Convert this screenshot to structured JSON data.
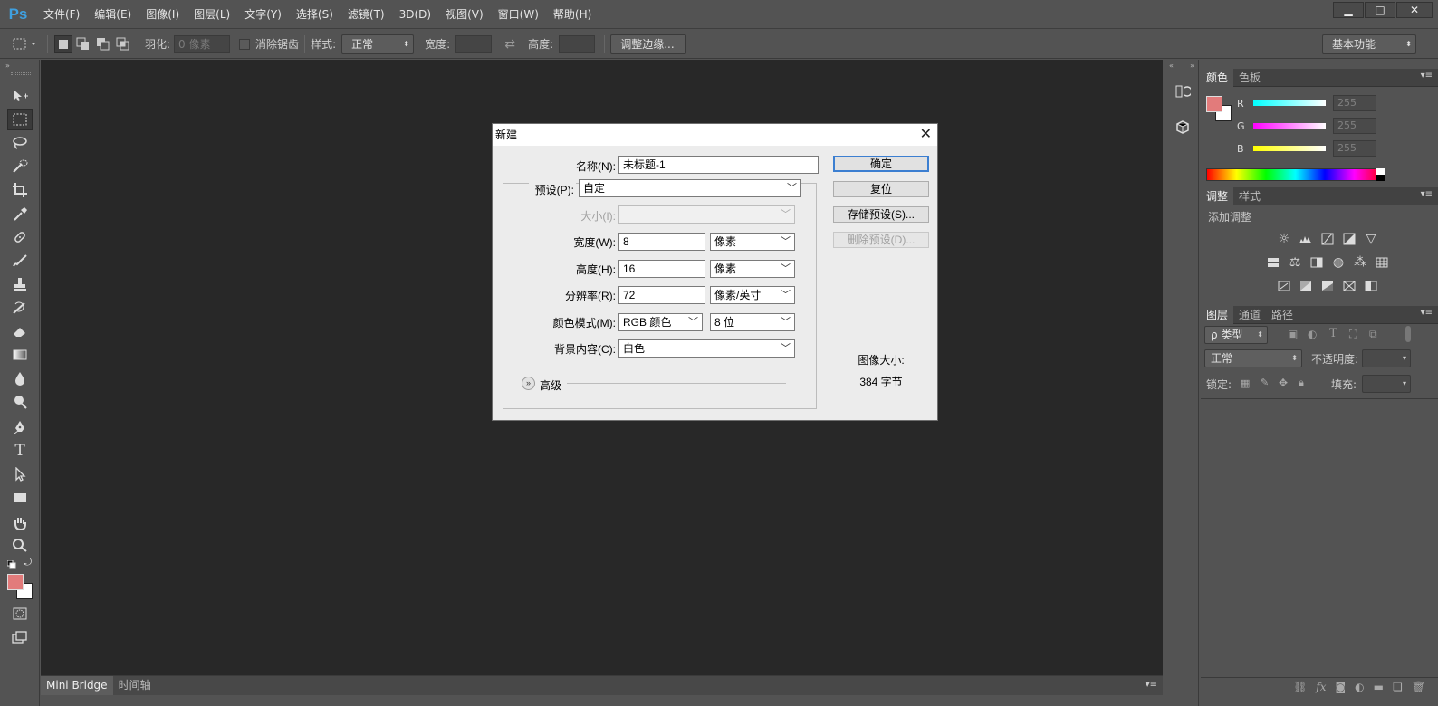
{
  "app": {
    "logo": "Ps"
  },
  "menu": [
    "文件(F)",
    "编辑(E)",
    "图像(I)",
    "图层(L)",
    "文字(Y)",
    "选择(S)",
    "滤镜(T)",
    "3D(D)",
    "视图(V)",
    "窗口(W)",
    "帮助(H)"
  ],
  "window_controls": {
    "minimize": "▁",
    "maximize": "□",
    "close": "✕"
  },
  "options": {
    "feather_label": "羽化:",
    "feather_value": "0 像素",
    "antialias_label": "消除锯齿",
    "style_label": "样式:",
    "style_value": "正常",
    "width_label": "宽度:",
    "height_label": "高度:",
    "refine_edge": "调整边缘...",
    "workspace": "基本功能"
  },
  "bottom_tabs": [
    "Mini Bridge",
    "时间轴"
  ],
  "colors": {
    "foreground": "#e27b7b",
    "background": "#ffffff",
    "canvas": "#282828",
    "panel": "#535353"
  },
  "color_panel": {
    "tabs": [
      "颜色",
      "色板"
    ],
    "channels": [
      {
        "label": "R",
        "value": "255"
      },
      {
        "label": "G",
        "value": "255"
      },
      {
        "label": "B",
        "value": "255"
      }
    ]
  },
  "adjust_panel": {
    "tabs": [
      "调整",
      "样式"
    ],
    "heading": "添加调整"
  },
  "layers_panel": {
    "tabs": [
      "图层",
      "通道",
      "路径"
    ],
    "filter_label": "ρ 类型",
    "blend_mode": "正常",
    "opacity_label": "不透明度:",
    "lock_label": "锁定:",
    "fill_label": "填充:"
  },
  "dialog": {
    "title": "新建",
    "close": "✕",
    "name_label": "名称(N):",
    "name_value": "未标题-1",
    "preset_label": "预设(P):",
    "preset_value": "自定",
    "size_label": "大小(I):",
    "width_label": "宽度(W):",
    "width_value": "8",
    "width_unit": "像素",
    "height_label": "高度(H):",
    "height_value": "16",
    "height_unit": "像素",
    "resolution_label": "分辨率(R):",
    "resolution_value": "72",
    "resolution_unit": "像素/英寸",
    "color_mode_label": "颜色模式(M):",
    "color_mode_value": "RGB 颜色",
    "bit_depth": "8 位",
    "background_label": "背景内容(C):",
    "background_value": "白色",
    "advanced_label": "高级",
    "buttons": {
      "ok": "确定",
      "reset": "复位",
      "save_preset": "存储预设(S)...",
      "delete_preset": "删除预设(D)..."
    },
    "image_size_label": "图像大小:",
    "image_size_value": "384 字节"
  }
}
